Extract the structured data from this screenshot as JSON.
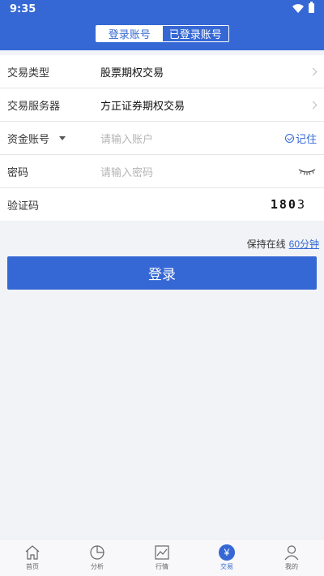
{
  "status_bar": {
    "time": "9:35"
  },
  "segmented": {
    "tabs": [
      {
        "label": "登录账号",
        "active": true
      },
      {
        "label": "已登录账号",
        "active": false
      }
    ]
  },
  "form": {
    "trade_type": {
      "label": "交易类型",
      "value": "股票期权交易"
    },
    "server": {
      "label": "交易服务器",
      "value": "方正证券期权交易"
    },
    "account": {
      "label": "资金账号",
      "placeholder": "请输入账户",
      "remember_label": "记住"
    },
    "password": {
      "label": "密码",
      "placeholder": "请输入密码"
    },
    "captcha": {
      "label": "验证码",
      "code_bold": "180",
      "code_rest": "3"
    }
  },
  "keep_online": {
    "label": "保持在线",
    "duration": "60分钟"
  },
  "login_button": {
    "label": "登录"
  },
  "colors": {
    "primary": "#3568d4",
    "background": "#f2f3f7"
  },
  "tabbar": {
    "items": [
      {
        "label": "首页",
        "icon": "home-icon",
        "active": false
      },
      {
        "label": "分析",
        "icon": "pie-chart-icon",
        "active": false
      },
      {
        "label": "行情",
        "icon": "line-chart-icon",
        "active": false
      },
      {
        "label": "交易",
        "icon": "yen-icon",
        "active": true
      },
      {
        "label": "我的",
        "icon": "person-icon",
        "active": false
      }
    ]
  }
}
